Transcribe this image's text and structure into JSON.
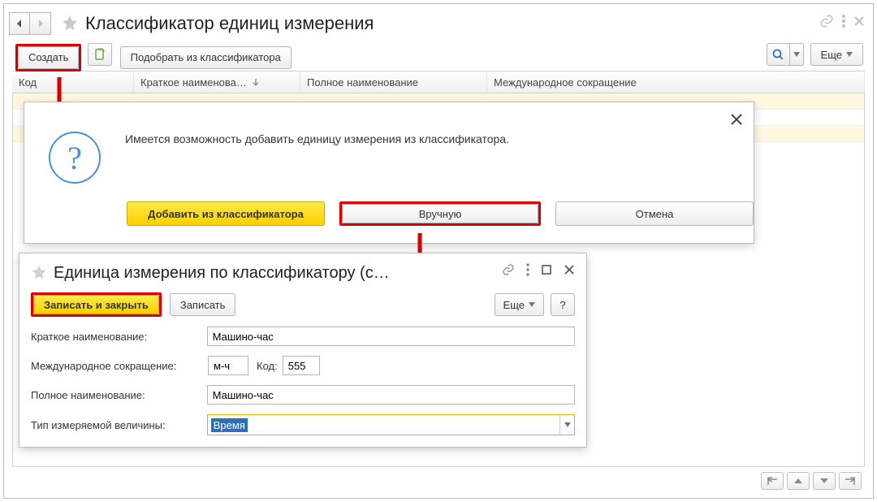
{
  "header": {
    "title": "Классификатор единиц измерения"
  },
  "toolbar": {
    "create_label": "Создать",
    "pick_label": "Подобрать из классификатора",
    "more_label": "Еще"
  },
  "table": {
    "col_code": "Код",
    "col_short": "Краткое наименова…",
    "col_full": "Полное наименование",
    "col_intl": "Международное сокращение"
  },
  "popup1": {
    "text": "Имеется возможность добавить единицу измерения из классификатора.",
    "add_label": "Добавить из классификатора",
    "manual_label": "Вручную",
    "cancel_label": "Отмена"
  },
  "popup2": {
    "title": "Единица измерения по классификатору (с…",
    "write_close_label": "Записать и закрыть",
    "write_label": "Записать",
    "more_label": "Еще",
    "help_label": "?",
    "fields": {
      "short_label": "Краткое наименование:",
      "short_value": "Машино-час",
      "intl_label": "Международное сокращение:",
      "intl_value": "м-ч",
      "code_label": "Код:",
      "code_value": "555",
      "full_label": "Полное наименование:",
      "full_value": "Машино-час",
      "type_label": "Тип измеряемой величины:",
      "type_value": "Время"
    }
  }
}
